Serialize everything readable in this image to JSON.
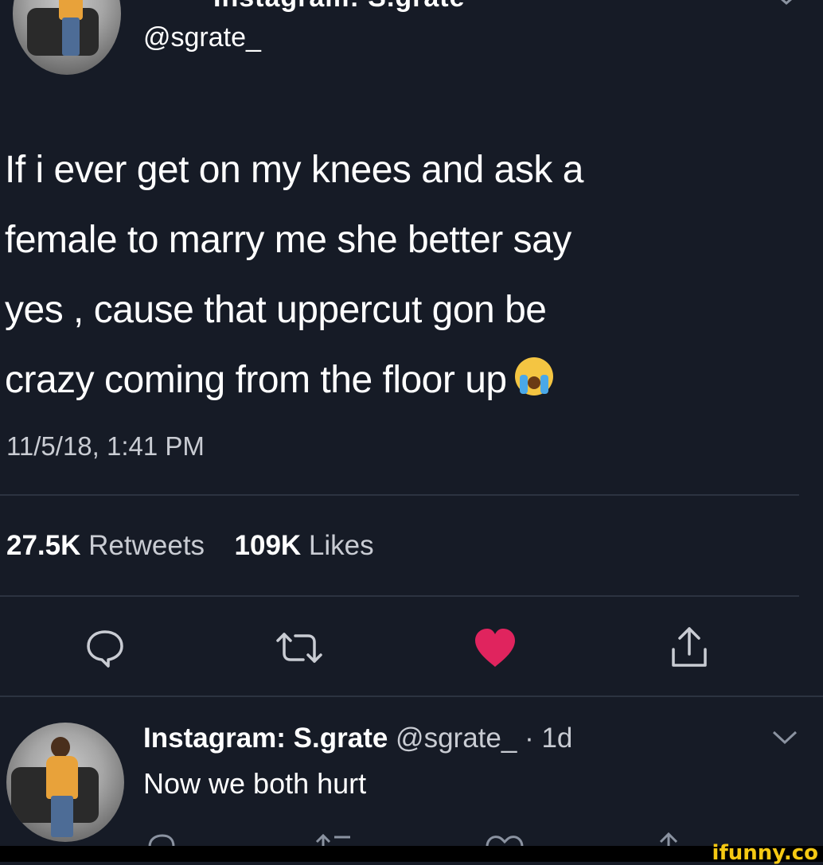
{
  "top_tweet": {
    "display_name": "Instagram: S.grate",
    "handle": "@sgrate_",
    "text_lines": [
      "If i ever get on my knees and ask a",
      "female to marry me she better say",
      "yes , cause that uppercut gon be",
      "crazy coming from the floor up"
    ],
    "emoji": "loudly-crying-face",
    "timestamp": "11/5/18, 1:41 PM",
    "retweets_count": "27.5K",
    "retweets_label": "Retweets",
    "likes_count": "109K",
    "likes_label": "Likes",
    "liked": true
  },
  "actions": {
    "reply_icon": "reply-icon",
    "retweet_icon": "retweet-icon",
    "like_icon": "heart-icon",
    "share_icon": "share-icon"
  },
  "reply_tweet": {
    "display_name": "Instagram: S.grate",
    "handle": "@sgrate_",
    "separator": "·",
    "age": "1d",
    "text": "Now we both hurt"
  },
  "watermark": "ifunny.co",
  "colors": {
    "background": "#161b26",
    "like_red": "#e0245e",
    "secondary_text": "#c9ccd3",
    "divider": "#2c3340",
    "watermark": "#f6c913"
  }
}
